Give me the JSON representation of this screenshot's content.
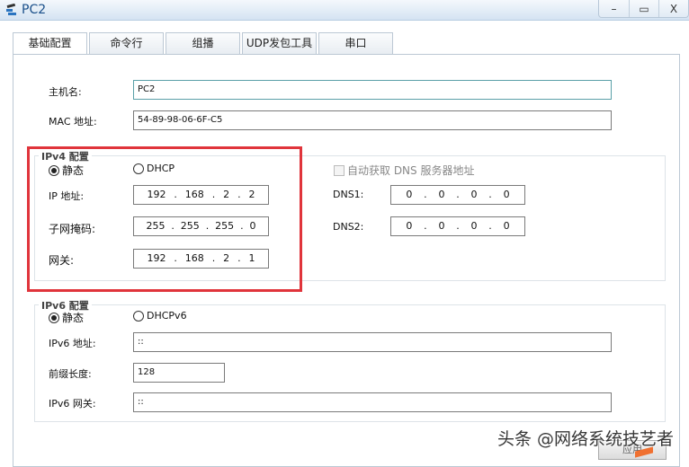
{
  "window": {
    "title": "PC2",
    "buttons": {
      "minimize": "–",
      "maximize": "▭",
      "close": "X"
    }
  },
  "tabs": [
    {
      "label": "基础配置",
      "active": true
    },
    {
      "label": "命令行"
    },
    {
      "label": "组播"
    },
    {
      "label": "UDP发包工具"
    },
    {
      "label": "串口"
    }
  ],
  "basic": {
    "hostname_label": "主机名:",
    "hostname": "PC2",
    "mac_label": "MAC 地址:",
    "mac": "54-89-98-06-6F-C5"
  },
  "ipv4": {
    "title": "IPv4 配置",
    "static_label": "静态",
    "dhcp_label": "DHCP",
    "mode": "static",
    "ip_label": "IP 地址:",
    "ip": [
      "192",
      "168",
      "2",
      "2"
    ],
    "mask_label": "子网掩码:",
    "mask": [
      "255",
      "255",
      "255",
      "0"
    ],
    "gw_label": "网关:",
    "gw": [
      "192",
      "168",
      "2",
      "1"
    ],
    "auto_dns_label": "自动获取 DNS 服务器地址",
    "dns1_label": "DNS1:",
    "dns1": [
      "0",
      "0",
      "0",
      "0"
    ],
    "dns2_label": "DNS2:",
    "dns2": [
      "0",
      "0",
      "0",
      "0"
    ]
  },
  "ipv6": {
    "title": "IPv6 配置",
    "static_label": "静态",
    "dhcp_label": "DHCPv6",
    "addr_label": "IPv6 地址:",
    "addr": "::",
    "prefix_label": "前缀长度:",
    "prefix": "128",
    "gw_label": "IPv6 网关:",
    "gw": "::"
  },
  "apply_label": "应用",
  "watermark": "头条 @网络系统技艺者",
  "colors": {
    "highlight": "#e0343b",
    "title": "#1a4f8a"
  }
}
